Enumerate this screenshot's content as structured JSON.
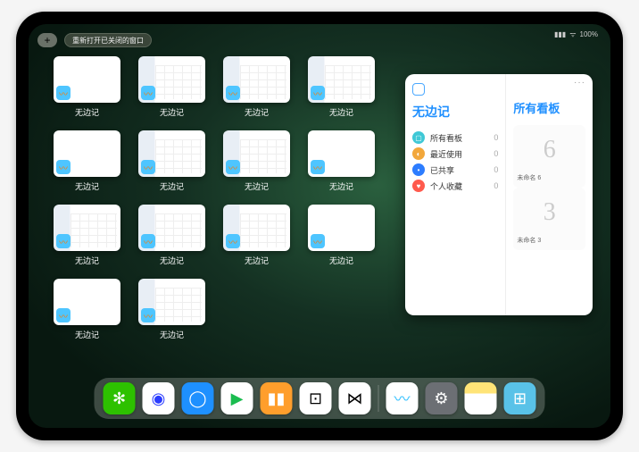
{
  "status": {
    "time": "",
    "wifi": "ᯤ",
    "battery": "100%",
    "signal": "▮▮▮"
  },
  "top": {
    "plus": "+",
    "reopen_closed": "重新打开已关闭的窗口"
  },
  "thumb_app_name": "无边记",
  "thumbs": [
    {
      "style": "blank"
    },
    {
      "style": "grid"
    },
    {
      "style": "grid"
    },
    {
      "style": "grid"
    },
    {
      "style": "blank"
    },
    {
      "style": "grid"
    },
    {
      "style": "grid"
    },
    {
      "style": "blank"
    },
    {
      "style": "grid"
    },
    {
      "style": "grid"
    },
    {
      "style": "grid"
    },
    {
      "style": "blank"
    },
    {
      "style": "blank"
    },
    {
      "style": "grid"
    }
  ],
  "card": {
    "title": "无边记",
    "rows": [
      {
        "icon_color": "#3fc8d6",
        "glyph": "▢",
        "label": "所有看板",
        "count": 0
      },
      {
        "icon_color": "#f2a73b",
        "glyph": "◐",
        "label": "最近使用",
        "count": 0
      },
      {
        "icon_color": "#2d7dff",
        "glyph": "�удь",
        "label": "已共享",
        "count": 0
      },
      {
        "icon_color": "#ff5a4d",
        "glyph": "♥",
        "label": "个人收藏",
        "count": 0
      }
    ],
    "right_title": "所有看板",
    "boards": [
      {
        "glyph": "6",
        "label": "未命名 6",
        "time": ""
      },
      {
        "glyph": "3",
        "label": "未命名 3",
        "time": ""
      }
    ],
    "more": "···"
  },
  "dock": [
    {
      "name": "wechat",
      "bg": "#2dc100",
      "glyph": "✻"
    },
    {
      "name": "quark",
      "bg": "#ffffff",
      "glyph": "◉",
      "fg": "#2a3cff"
    },
    {
      "name": "qqbrowser",
      "bg": "#1e90ff",
      "glyph": "◯"
    },
    {
      "name": "play",
      "bg": "#ffffff",
      "glyph": "▶",
      "fg": "#1abc4f"
    },
    {
      "name": "books",
      "bg": "#ff9e2c",
      "glyph": "▮▮",
      "fg": "#fff"
    },
    {
      "name": "dice",
      "bg": "#ffffff",
      "glyph": "⊡",
      "fg": "#000"
    },
    {
      "name": "connect",
      "bg": "#ffffff",
      "glyph": "⋈",
      "fg": "#000"
    },
    {
      "name": "freeform",
      "bg": "#ffffff",
      "glyph": "〰",
      "fg": "#33c1ff"
    },
    {
      "name": "settings",
      "bg": "#6c6f74",
      "glyph": "⚙"
    },
    {
      "name": "notes",
      "bg": "linear-gradient(#ffe477 35%,#fff 35%)",
      "glyph": ""
    },
    {
      "name": "app-grid",
      "bg": "#59c2e8",
      "glyph": "⊞"
    }
  ]
}
